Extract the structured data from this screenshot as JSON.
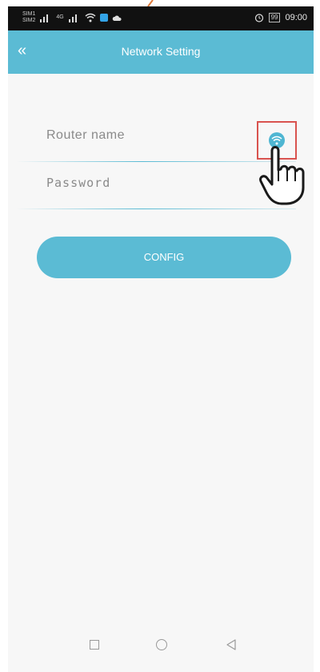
{
  "status_bar": {
    "time": "09:00",
    "battery": "99",
    "sim_left_labels": [
      "SIM1",
      "SIM2"
    ],
    "signal_label": "4G",
    "icons": [
      "signal-icon",
      "signal-icon",
      "wifi-icon",
      "app-icon",
      "cloud-icon",
      "alarm-icon",
      "battery-icon"
    ]
  },
  "app_bar": {
    "title": "Network Setting",
    "back_icon": "double-chevron-left-icon"
  },
  "form": {
    "router_placeholder": "Router name",
    "password_placeholder": "Password",
    "wifi_button_icon": "wifi-icon"
  },
  "config_button": {
    "label": "CONFIG"
  },
  "nav_bar": {
    "icons": [
      "recents-icon",
      "home-icon",
      "back-icon"
    ]
  },
  "colors": {
    "accent": "#5bbbd4",
    "highlight": "#d9534f",
    "background": "#f7f7f7"
  }
}
